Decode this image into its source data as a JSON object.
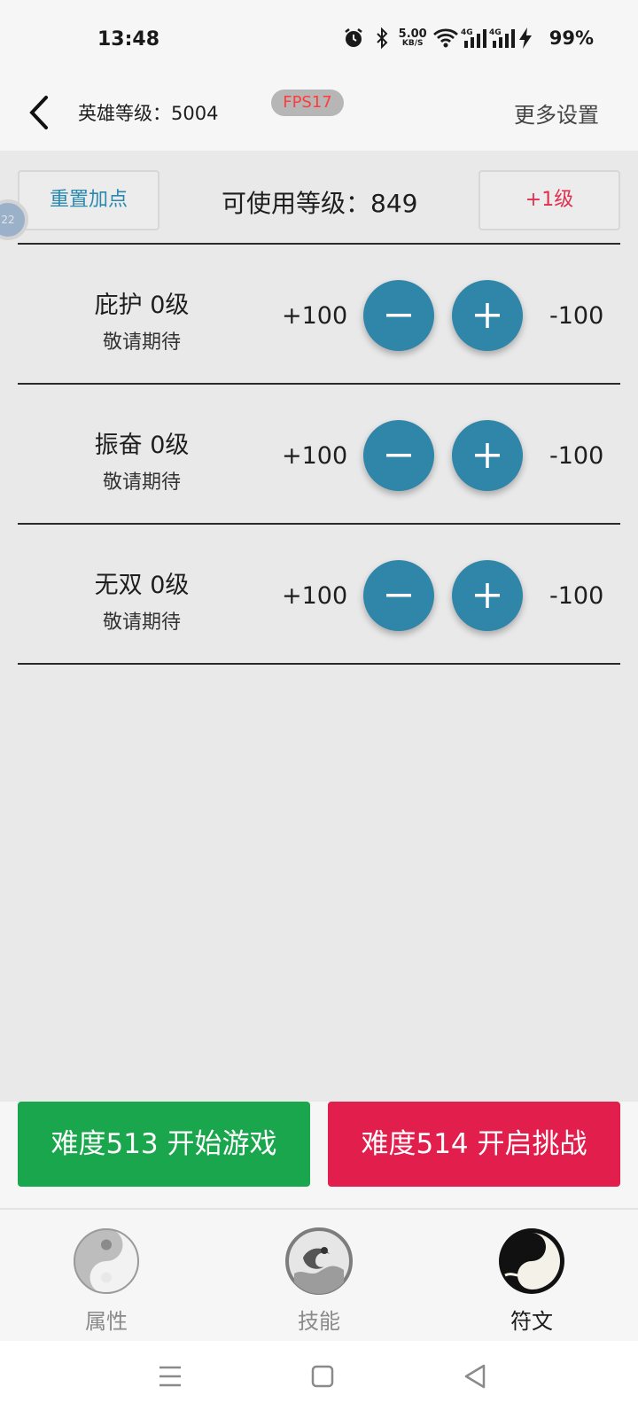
{
  "status_bar": {
    "time": "13:48",
    "net_speed_value": "5.00",
    "net_speed_unit": "KB/S",
    "battery": "99%",
    "icons": [
      "alarm-icon",
      "bluetooth-icon",
      "wifi-icon",
      "signal-4g-icon",
      "signal-4g-icon",
      "charging-icon"
    ]
  },
  "header": {
    "hero_level": "英雄等级：5004",
    "fps": "FPS17",
    "more_settings": "更多设置"
  },
  "top_row": {
    "reset_label": "重置加点",
    "available_level": "可使用等级：849",
    "plus_level_label": "+1级",
    "float_ball_text": "22"
  },
  "skills": [
    {
      "name": "庇护 0级",
      "desc": "敬请期待",
      "plus_value": "+100",
      "minus_value": "-100"
    },
    {
      "name": "振奋 0级",
      "desc": "敬请期待",
      "plus_value": "+100",
      "minus_value": "-100"
    },
    {
      "name": "无双 0级",
      "desc": "敬请期待",
      "plus_value": "+100",
      "minus_value": "-100"
    }
  ],
  "actions": {
    "start_label": "难度513 开始游戏",
    "challenge_label": "难度514 开启挑战"
  },
  "tabs": [
    {
      "label": "属性",
      "active": false
    },
    {
      "label": "技能",
      "active": false
    },
    {
      "label": "符文",
      "active": true
    }
  ],
  "colors": {
    "accent_blue": "#2f86a8",
    "start_green": "#1aa64c",
    "challenge_red": "#e21e4d",
    "fps_red": "#ff3b3b"
  }
}
